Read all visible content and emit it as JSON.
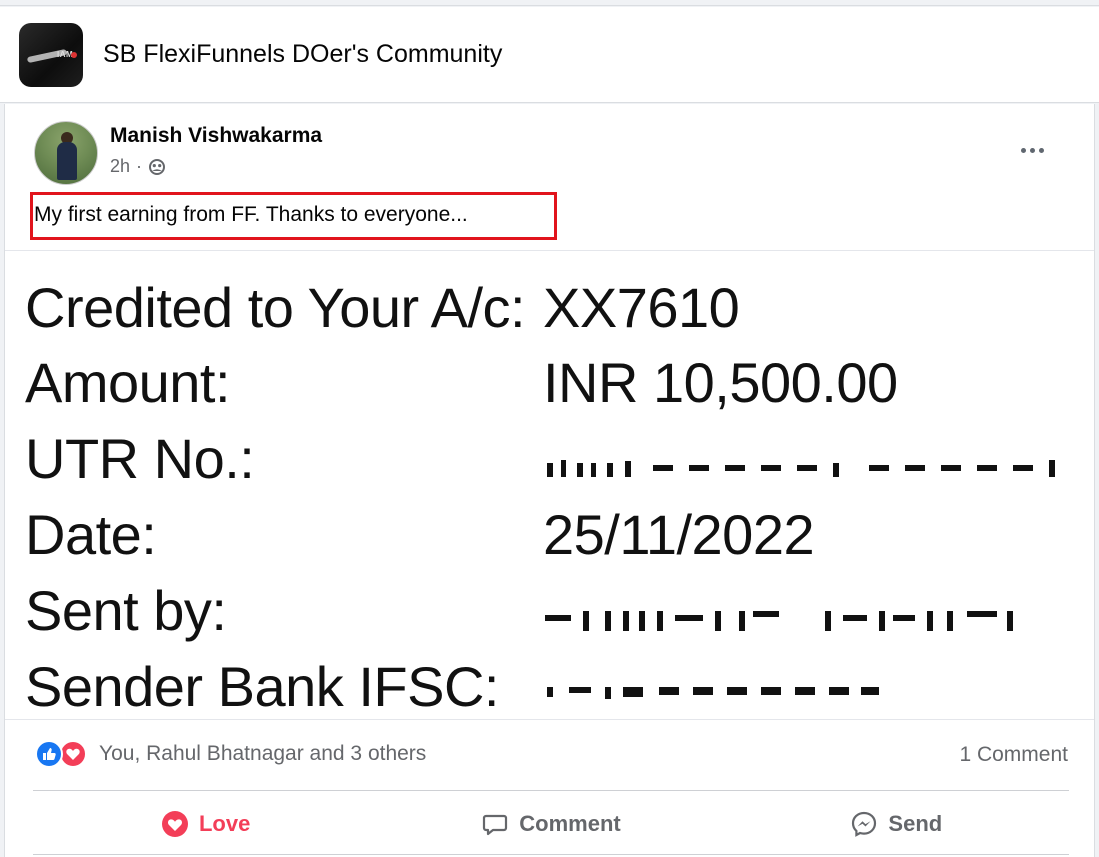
{
  "group": {
    "name": "SB FlexiFunnels DOer's Community",
    "avatar_text": "IAM"
  },
  "post": {
    "author": "Manish Vishwakarma",
    "time": "2h",
    "separator": "·",
    "audience_icon": "group-audience-icon",
    "text": "My first earning from FF. Thanks to everyone...",
    "highlight_color": "#e1141c"
  },
  "image": {
    "rows": [
      {
        "label": "Credited to Your A/c:",
        "value": "XX7610"
      },
      {
        "label": "Amount:",
        "value": "INR 10,500.00"
      },
      {
        "label": "UTR No.:",
        "value": ""
      },
      {
        "label": "Date:",
        "value": "25/11/2022"
      },
      {
        "label": "Sent by:",
        "value": ""
      },
      {
        "label": "Sender Bank IFSC:",
        "value": ""
      }
    ]
  },
  "reactions": {
    "names": "You, Rahul Bhatnagar and 3 others",
    "comment_count": "1 Comment",
    "like_color": "#1877f2",
    "love_color": "#f33e58"
  },
  "actions": {
    "love": "Love",
    "comment": "Comment",
    "send": "Send"
  }
}
